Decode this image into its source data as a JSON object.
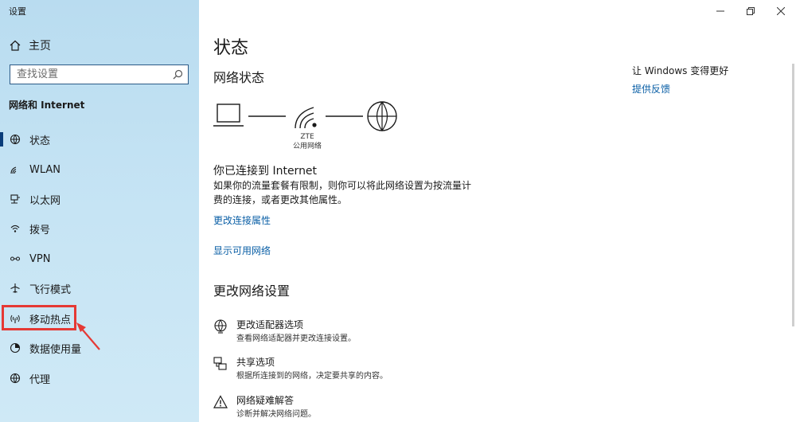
{
  "app": {
    "title": "设置"
  },
  "sidebar": {
    "home_label": "主页",
    "search_placeholder": "查找设置",
    "section_title": "网络和 Internet",
    "items": [
      {
        "label": "状态",
        "icon": "globe-status-icon"
      },
      {
        "label": "WLAN",
        "icon": "wifi-icon"
      },
      {
        "label": "以太网",
        "icon": "ethernet-icon"
      },
      {
        "label": "拨号",
        "icon": "dialup-icon"
      },
      {
        "label": "VPN",
        "icon": "vpn-icon"
      },
      {
        "label": "飞行模式",
        "icon": "airplane-icon"
      },
      {
        "label": "移动热点",
        "icon": "hotspot-icon"
      },
      {
        "label": "数据使用量",
        "icon": "data-usage-icon"
      },
      {
        "label": "代理",
        "icon": "globe-icon"
      }
    ]
  },
  "main": {
    "title": "状态",
    "network_status_title": "网络状态",
    "network_name": "ZTE",
    "network_type": "公用网络",
    "connected_text": "你已连接到 Internet",
    "description": "如果你的流量套餐有限制，则你可以将此网络设置为按流量计费的连接，或者更改其他属性。",
    "link_change_props": "更改连接属性",
    "link_show_networks": "显示可用网络",
    "change_settings_title": "更改网络设置",
    "options": [
      {
        "title": "更改适配器选项",
        "subtitle": "查看网络适配器并更改连接设置。"
      },
      {
        "title": "共享选项",
        "subtitle": "根据所连接到的网络，决定要共享的内容。"
      },
      {
        "title": "网络疑难解答",
        "subtitle": "诊断并解决网络问题。"
      }
    ]
  },
  "right": {
    "heading": "让 Windows 变得更好",
    "feedback_link": "提供反馈"
  },
  "colors": {
    "accent": "#0a5fa6",
    "sidebar_bg": "#c6e4f4",
    "highlight": "#e53935"
  }
}
